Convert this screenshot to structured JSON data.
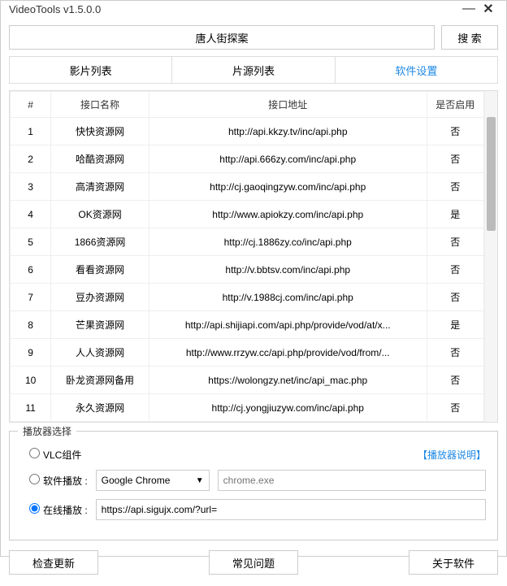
{
  "window": {
    "title": "VideoTools v1.5.0.0"
  },
  "search": {
    "value": "唐人街探案",
    "button": "搜  索"
  },
  "tabs": [
    "影片列表",
    "片源列表",
    "软件设置"
  ],
  "active_tab": 2,
  "table": {
    "headers": {
      "num": "#",
      "name": "接口名称",
      "url": "接口地址",
      "enabled": "是否启用"
    },
    "rows": [
      {
        "num": "1",
        "name": "快快资源网",
        "url": "http://api.kkzy.tv/inc/api.php",
        "enabled": "否"
      },
      {
        "num": "2",
        "name": "哈酷资源网",
        "url": "http://api.666zy.com/inc/api.php",
        "enabled": "否"
      },
      {
        "num": "3",
        "name": "高清资源网",
        "url": "http://cj.gaoqingzyw.com/inc/api.php",
        "enabled": "否"
      },
      {
        "num": "4",
        "name": "OK资源网",
        "url": "http://www.apiokzy.com/inc/api.php",
        "enabled": "是"
      },
      {
        "num": "5",
        "name": "1866资源网",
        "url": "http://cj.1886zy.co/inc/api.php",
        "enabled": "否"
      },
      {
        "num": "6",
        "name": "看看资源网",
        "url": "http://v.bbtsv.com/inc/api.php",
        "enabled": "否"
      },
      {
        "num": "7",
        "name": "豆办资源网",
        "url": "http://v.1988cj.com/inc/api.php",
        "enabled": "否"
      },
      {
        "num": "8",
        "name": "芒果资源网",
        "url": "http://api.shijiapi.com/api.php/provide/vod/at/x...",
        "enabled": "是"
      },
      {
        "num": "9",
        "name": "人人资源网",
        "url": "http://www.rrzyw.cc/api.php/provide/vod/from/...",
        "enabled": "否"
      },
      {
        "num": "10",
        "name": "卧龙资源网备用",
        "url": "https://wolongzy.net/inc/api_mac.php",
        "enabled": "否"
      },
      {
        "num": "11",
        "name": "永久资源网",
        "url": "http://cj.yongjiuzyw.com/inc/api.php",
        "enabled": "否"
      }
    ]
  },
  "player": {
    "group_title": "播放器选择",
    "vlc_label": "VLC组件",
    "help_link": "【播放器说明】",
    "software_label": "软件播放 :",
    "software_select": "Google Chrome",
    "software_path": "chrome.exe",
    "online_label": "在线播放 :",
    "online_url": "https://api.sigujx.com/?url=",
    "selected": "online"
  },
  "bottom": {
    "update": "检查更新",
    "faq": "常见问题",
    "about": "关于软件"
  }
}
